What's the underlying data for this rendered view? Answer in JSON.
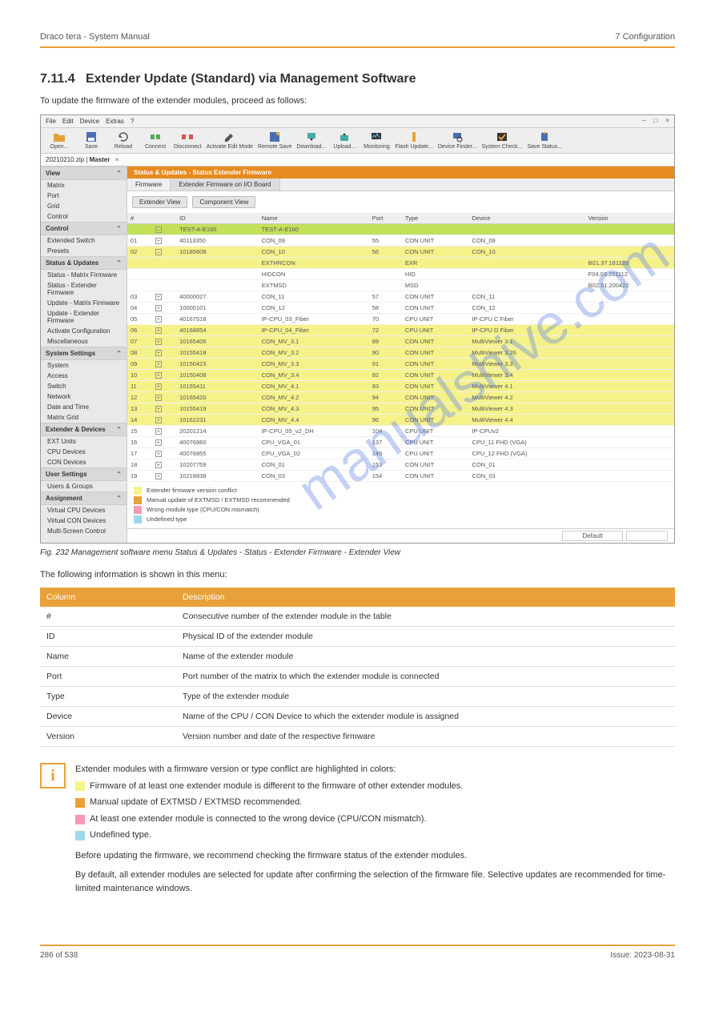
{
  "header": {
    "left": "Draco tera - System Manual",
    "right": "7 Configuration"
  },
  "section_num": "7.11.4",
  "section_title": "Extender Update (Standard) via Management Software",
  "intro": "To update the firmware of the extender modules, proceed as follows:",
  "fig_caption": "Fig. 232 Management software menu Status & Updates - Status - Extender Firmware - Extender View",
  "cols_intro": "The following information is shown in this menu:",
  "app": {
    "menu": [
      "File",
      "Edit",
      "Device",
      "Extras",
      "?"
    ],
    "winctl": [
      "–",
      "□",
      "×"
    ],
    "toolbar": [
      {
        "label": "Open...",
        "icon": "folder"
      },
      {
        "label": "Save",
        "icon": "save"
      },
      {
        "label": "Reload",
        "icon": "reload"
      },
      {
        "label": "Connect",
        "icon": "connect"
      },
      {
        "label": "Disconnect",
        "icon": "disconnect"
      },
      {
        "label": "Activate Edit Mode",
        "icon": "edit"
      },
      {
        "label": "Remote Save",
        "icon": "remotesave"
      },
      {
        "label": "Download...",
        "icon": "download"
      },
      {
        "label": "Upload...",
        "icon": "upload"
      },
      {
        "label": "Monitoring",
        "icon": "monitor"
      },
      {
        "label": "Flash Update...",
        "icon": "flash"
      },
      {
        "label": "Device Finder...",
        "icon": "finder"
      },
      {
        "label": "System Check...",
        "icon": "check"
      },
      {
        "label": "Save Status...",
        "icon": "savestatus"
      }
    ],
    "filetab": {
      "name": "20210210.zip",
      "master": "Master"
    },
    "sidebar": [
      {
        "title": "View",
        "items": [
          "Matrix",
          "Port",
          "Grid",
          "Control"
        ]
      },
      {
        "title": "Control",
        "items": [
          "Extended Switch",
          "Presets"
        ]
      },
      {
        "title": "Status & Updates",
        "items": [
          "Status - Matrix Firmware",
          "Status - Extender Firmware",
          "Update - Matrix Firmware",
          "Update - Extender Firmware",
          "Activate Configuration",
          "Miscellaneous"
        ]
      },
      {
        "title": "System Settings",
        "items": [
          "System",
          "Access",
          "Switch",
          "Network",
          "Date and Time",
          "Matrix Grid"
        ]
      },
      {
        "title": "Extender & Devices",
        "items": [
          "EXT Units",
          "CPU Devices",
          "CON Devices"
        ]
      },
      {
        "title": "User Settings",
        "items": [
          "Users & Groups"
        ]
      },
      {
        "title": "Assignment",
        "items": [
          "Virtual CPU Devices",
          "Virtual CON Devices",
          "Multi-Screen Control"
        ]
      }
    ],
    "content_title": "Status & Updates - Status Extender Firmware",
    "tabs": [
      "Firmware",
      "Extender Firmware on I/O Board"
    ],
    "btns": [
      "Extender View",
      "Component View"
    ],
    "thead": [
      "#",
      "",
      "ID",
      "Name",
      "Port",
      "Type",
      "Device",
      "Version"
    ],
    "rows": [
      {
        "cls": "lime",
        "n": "",
        "exp": "–",
        "id": "TEST-A-E160",
        "name": "TEST-A-E160",
        "port": "",
        "type": "",
        "device": "",
        "ver": ""
      },
      {
        "cls": "white",
        "n": "01",
        "exp": "+",
        "id": "40113350",
        "name": "CON_09",
        "port": "55",
        "type": "CON UNIT",
        "device": "CON_09",
        "ver": ""
      },
      {
        "cls": "yellow",
        "n": "02",
        "exp": "–",
        "id": "10185608",
        "name": "CON_10",
        "port": "56",
        "type": "CON UNIT",
        "device": "CON_10",
        "ver": ""
      },
      {
        "cls": "yellow",
        "n": "",
        "exp": "",
        "id": "",
        "name": "EXTHRCON",
        "port": "",
        "type": "EXR",
        "device": "",
        "ver": "B01.37.181128"
      },
      {
        "cls": "white",
        "n": "",
        "exp": "",
        "id": "",
        "name": "HIDCON",
        "port": "",
        "type": "HID",
        "device": "",
        "ver": "F04.03.201112"
      },
      {
        "cls": "white",
        "n": "",
        "exp": "",
        "id": "",
        "name": "EXTMSD",
        "port": "",
        "type": "MSD",
        "device": "",
        "ver": "B02.51.200422"
      },
      {
        "cls": "white",
        "n": "03",
        "exp": "+",
        "id": "40000027",
        "name": "CON_11",
        "port": "57",
        "type": "CON UNIT",
        "device": "CON_11",
        "ver": ""
      },
      {
        "cls": "white",
        "n": "04",
        "exp": "+",
        "id": "10000101",
        "name": "CON_12",
        "port": "58",
        "type": "CON UNIT",
        "device": "CON_12",
        "ver": ""
      },
      {
        "cls": "white",
        "n": "05",
        "exp": "+",
        "id": "40167518",
        "name": "IP-CPU_03_Fiber",
        "port": "70",
        "type": "CPU UNIT",
        "device": "IP-CPU C Fiber",
        "ver": ""
      },
      {
        "cls": "yellow",
        "n": "06",
        "exp": "+",
        "id": "40168854",
        "name": "IP-CPU_04_Fiber",
        "port": "72",
        "type": "CPU UNIT",
        "device": "IP-CPU D Fiber",
        "ver": ""
      },
      {
        "cls": "yellow",
        "n": "07",
        "exp": "+",
        "id": "10165406",
        "name": "CON_MV_3.1",
        "port": "89",
        "type": "CON UNIT",
        "device": "MultiViewer 3.1",
        "ver": ""
      },
      {
        "cls": "yellow",
        "n": "08",
        "exp": "+",
        "id": "10155418",
        "name": "CON_MV_3.2",
        "port": "90",
        "type": "CON UNIT",
        "device": "MultiViewer 3.26",
        "ver": ""
      },
      {
        "cls": "yellow",
        "n": "09",
        "exp": "+",
        "id": "10150423",
        "name": "CON_MV_3.3",
        "port": "91",
        "type": "CON UNIT",
        "device": "MultiViewer 3.3",
        "ver": ""
      },
      {
        "cls": "yellow",
        "n": "10",
        "exp": "+",
        "id": "10150408",
        "name": "CON_MV_3.4",
        "port": "92",
        "type": "CON UNIT",
        "device": "MultiViewer 3.4",
        "ver": ""
      },
      {
        "cls": "yellow",
        "n": "11",
        "exp": "+",
        "id": "10155411",
        "name": "CON_MV_4.1",
        "port": "93",
        "type": "CON UNIT",
        "device": "MultiViewer 4.1",
        "ver": ""
      },
      {
        "cls": "yellow",
        "n": "12",
        "exp": "+",
        "id": "10165420",
        "name": "CON_MV_4.2",
        "port": "94",
        "type": "CON UNIT",
        "device": "MultiViewer 4.2",
        "ver": ""
      },
      {
        "cls": "yellow",
        "n": "13",
        "exp": "+",
        "id": "10155419",
        "name": "CON_MV_4.3",
        "port": "95",
        "type": "CON UNIT",
        "device": "MultiViewer 4.3",
        "ver": ""
      },
      {
        "cls": "yellow",
        "n": "14",
        "exp": "+",
        "id": "10162231",
        "name": "CON_MV_4.4",
        "port": "96",
        "type": "CON UNIT",
        "device": "MultiViewer 4.4",
        "ver": ""
      },
      {
        "cls": "white",
        "n": "15",
        "exp": "+",
        "id": "20201214",
        "name": "IP-CPU_05_v2_DH",
        "port": "104",
        "type": "CPU UNIT",
        "device": "IP-CPUv2",
        "ver": ""
      },
      {
        "cls": "white",
        "n": "16",
        "exp": "+",
        "id": "40076860",
        "name": "CPU_VGA_01",
        "port": "137",
        "type": "CPU UNIT",
        "device": "CPU_11 FHD (VGA)",
        "ver": ""
      },
      {
        "cls": "white",
        "n": "17",
        "exp": "+",
        "id": "40076855",
        "name": "CPU_VGA_02",
        "port": "145",
        "type": "CPU UNIT",
        "device": "CPU_12 FHD (VGA)",
        "ver": ""
      },
      {
        "cls": "white",
        "n": "18",
        "exp": "+",
        "id": "10207759",
        "name": "CON_01",
        "port": "153",
        "type": "CON UNIT",
        "device": "CON_01",
        "ver": ""
      },
      {
        "cls": "white",
        "n": "19",
        "exp": "+",
        "id": "10218838",
        "name": "CON_03",
        "port": "154",
        "type": "CON UNIT",
        "device": "CON_03",
        "ver": ""
      }
    ],
    "legend": [
      {
        "color": "#f5f28a",
        "text": "Extender firmware version conflict"
      },
      {
        "color": "#e8a13a",
        "text": "Manual update of EXTMSD / EXTMSD recommended"
      },
      {
        "color": "#f49ab6",
        "text": "Wrong module type (CPU/CON mismatch)"
      },
      {
        "color": "#9cd7ec",
        "text": "Undefined type"
      }
    ],
    "statusbar": "Default"
  },
  "cols": {
    "head": [
      "Column",
      "Description"
    ],
    "rows": [
      [
        "#",
        "Consecutive number of the extender module in the table"
      ],
      [
        "ID",
        "Physical ID of the extender module"
      ],
      [
        "Name",
        "Name of the extender module"
      ],
      [
        "Port",
        "Port number of the matrix to which the extender module is connected"
      ],
      [
        "Type",
        "Type of the extender module"
      ],
      [
        "Device",
        "Name of the CPU / CON Device to which the extender module is assigned"
      ],
      [
        "Version",
        "Version number and date of the respective firmware"
      ]
    ]
  },
  "info": {
    "lead": "Extender modules with a firmware version or type conflict are highlighted in colors:",
    "items": [
      {
        "color": "#f5f28a",
        "text": "Firmware of at least one extender module is different to the firmware of other extender modules."
      },
      {
        "color": "#e8a13a",
        "text": "Manual update of EXTMSD / EXTMSD recommended."
      },
      {
        "color": "#f49ab6",
        "text": "At least one extender module is connected to the wrong device (CPU/CON mismatch)."
      },
      {
        "color": "#9cd7ec",
        "text": "Undefined type."
      }
    ],
    "tail1": "Before updating the firmware, we recommend checking the firmware status of the extender modules.",
    "tail2": "By default, all extender modules are selected for update after confirming the selection of the firmware file. Selective updates are recommended for time-limited maintenance windows."
  },
  "footer": {
    "left": "286 of 538",
    "right": "Issue: 2023-08-31"
  }
}
